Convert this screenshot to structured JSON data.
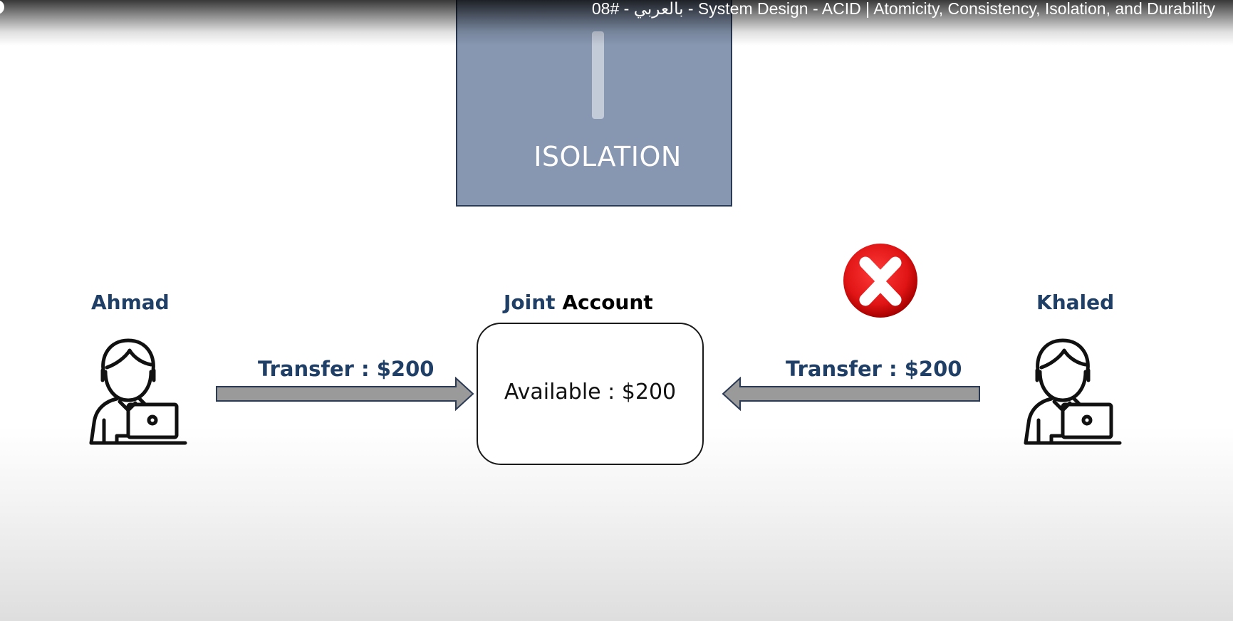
{
  "video": {
    "title": "08# - بالعربي - System Design - ACID | Atomicity, Consistency, Isolation, and Durability"
  },
  "slide": {
    "section_label": "ISOLATION",
    "card_color": "#8797b1",
    "left_person": {
      "name": "Ahmad",
      "icon": "user-laptop-icon"
    },
    "right_person": {
      "name": "Khaled",
      "icon": "user-laptop-icon"
    },
    "account": {
      "title_part1": "Joint",
      "title_part2": "Account",
      "available": "Available : $200"
    },
    "left_transfer": {
      "label": "Transfer : $200",
      "direction": "right"
    },
    "right_transfer": {
      "label": "Transfer : $200",
      "direction": "left",
      "status": "rejected",
      "status_icon": "red-x-icon"
    },
    "colors": {
      "name_blue": "#1f3f66",
      "arrow_fill": "#9a9a9a",
      "arrow_stroke": "#2b3a55",
      "reject_red": "#e01414"
    }
  }
}
